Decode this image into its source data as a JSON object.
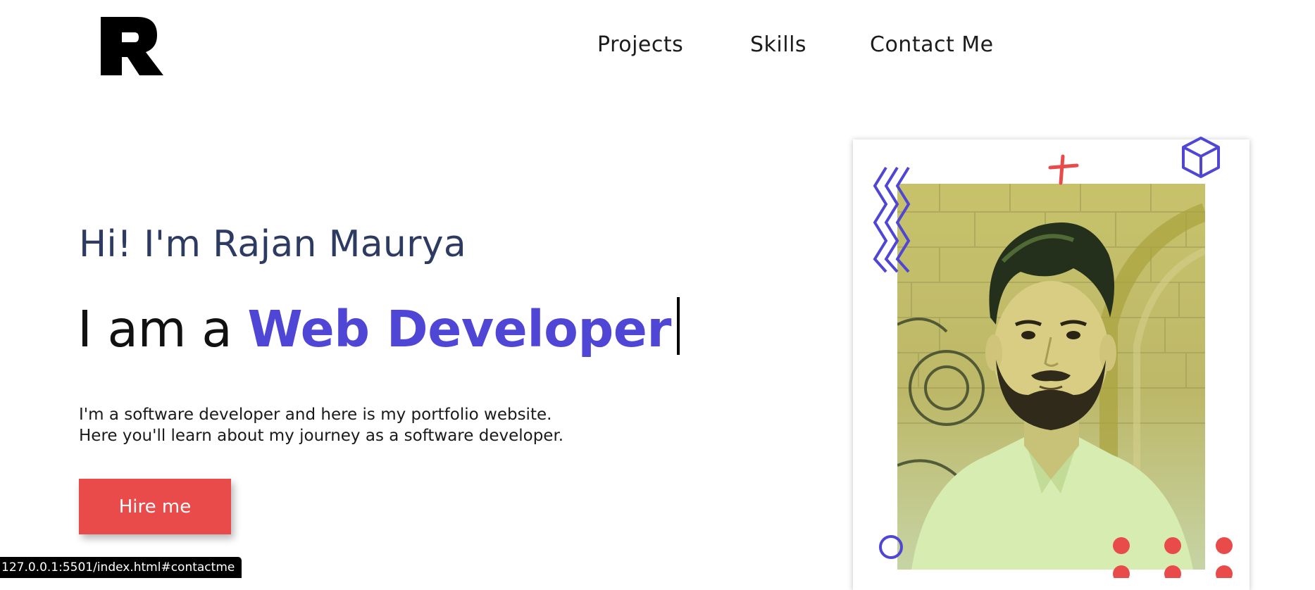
{
  "nav": {
    "items": [
      {
        "label": "Projects"
      },
      {
        "label": "Skills"
      },
      {
        "label": "Contact Me"
      }
    ]
  },
  "hero": {
    "greeting": "Hi! I'm Rajan Maurya",
    "role_prefix": "I am a ",
    "role_highlight": "Web Developer",
    "description_line1": "I'm a software developer and here is my portfolio website.",
    "description_line2": "Here you'll learn about my journey as a software developer.",
    "cta_label": "Hire me"
  },
  "status_bar": {
    "url": "127.0.0.1:5501/index.html#contactme"
  },
  "colors": {
    "accent": "#4f46d6",
    "greeting": "#2d3b63",
    "cta": "#e94a4a",
    "deco_red": "#e94a4a"
  },
  "icons": {
    "logo": "r-logo",
    "zigzag": "zigzag-icon",
    "plus": "plus-icon",
    "cube": "cube-icon",
    "circle": "circle-icon",
    "dots": "dots-icon"
  }
}
